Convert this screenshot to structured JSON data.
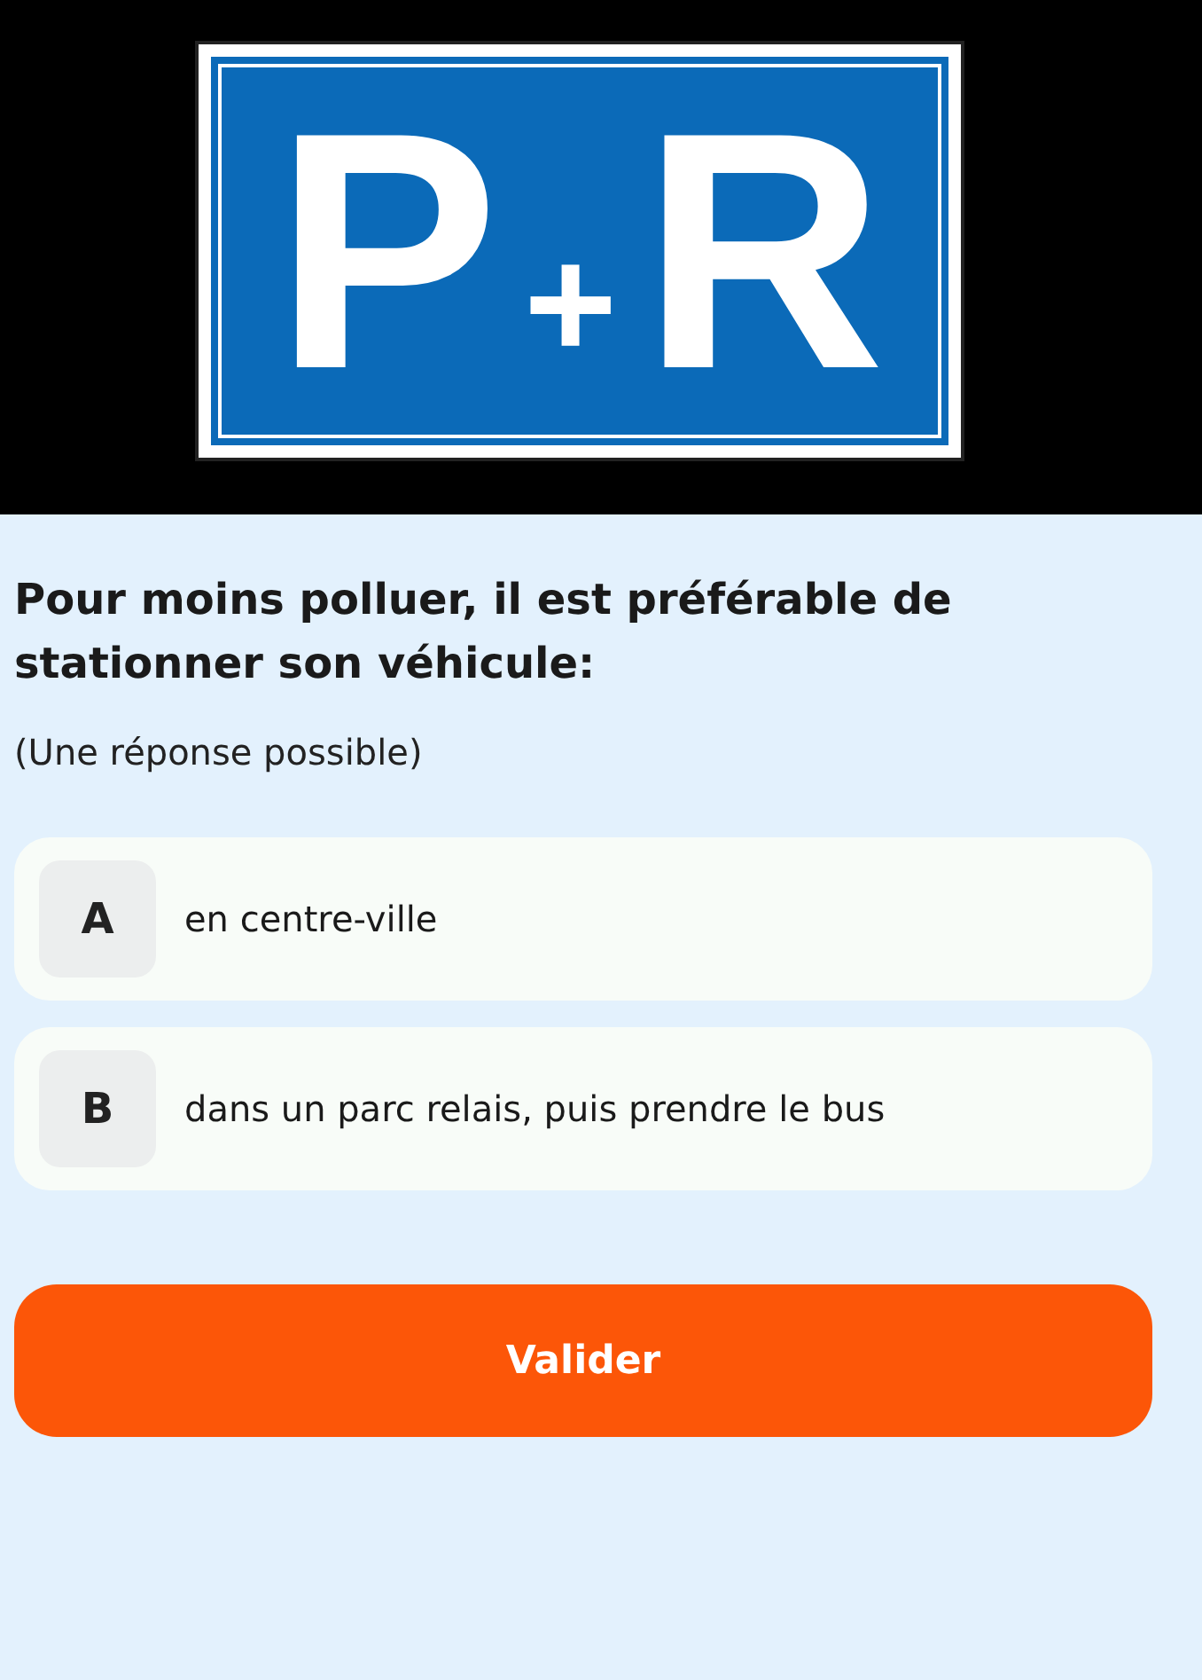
{
  "sign": {
    "letters": [
      "P",
      "+",
      "R"
    ]
  },
  "question": "Pour moins polluer, il est préférable de stationner son véhicule:",
  "hint": "(Une réponse possible)",
  "options": [
    {
      "letter": "A",
      "text": "en centre-ville",
      "selected": false
    },
    {
      "letter": "B",
      "text": "dans un parc relais, puis prendre le bus",
      "selected": false
    }
  ],
  "submit": "Valider"
}
